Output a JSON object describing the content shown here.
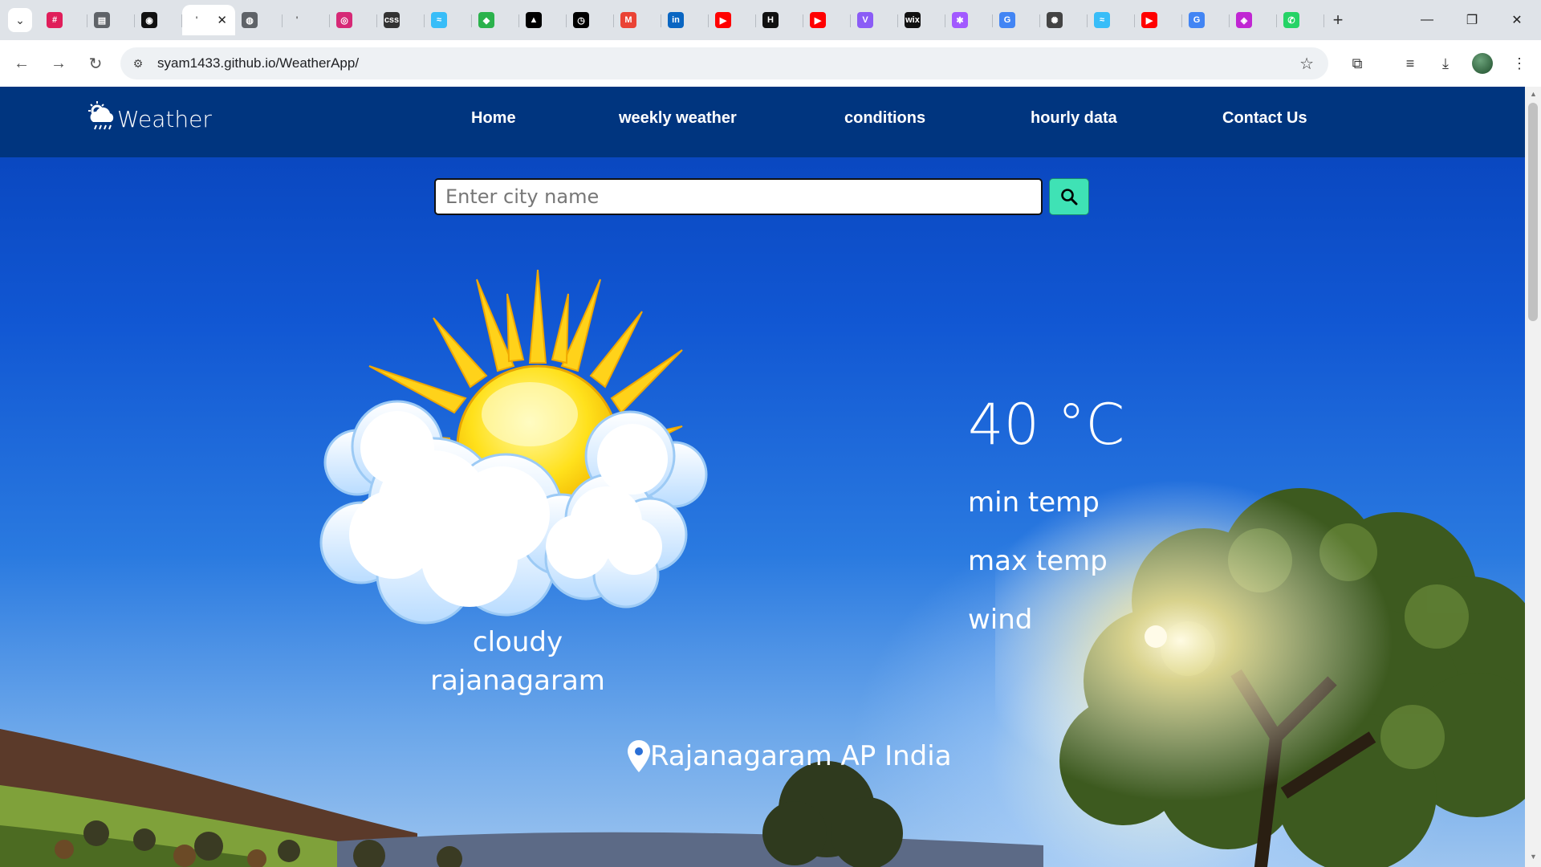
{
  "browser": {
    "tabs": [
      {
        "icon": "slack-icon",
        "color": "#e01e5a",
        "glyph": "#"
      },
      {
        "icon": "doc-icon",
        "color": "#5f6368",
        "glyph": "▤"
      },
      {
        "icon": "github-icon",
        "color": "#111111",
        "glyph": "◉"
      },
      {
        "icon": "active-tab-icon",
        "color": "#ffffff",
        "glyph": "'"
      },
      {
        "icon": "globe-icon",
        "color": "#5f6368",
        "glyph": "◍"
      },
      {
        "icon": "blank-icon",
        "color": "#cccccc",
        "glyph": "'"
      },
      {
        "icon": "instagram-icon",
        "color": "#d62976",
        "glyph": "◎"
      },
      {
        "icon": "css-icon",
        "color": "#333333",
        "glyph": "css"
      },
      {
        "icon": "tailwind-icon",
        "color": "#38bdf8",
        "glyph": "≈"
      },
      {
        "icon": "feedly-icon",
        "color": "#2bb24c",
        "glyph": "◆"
      },
      {
        "icon": "vercel-icon",
        "color": "#000000",
        "glyph": "▲"
      },
      {
        "icon": "alarm-icon",
        "color": "#000000",
        "glyph": "◷"
      },
      {
        "icon": "gmail-icon",
        "color": "#ea4335",
        "glyph": "M"
      },
      {
        "icon": "linkedin-icon",
        "color": "#0a66c2",
        "glyph": "in"
      },
      {
        "icon": "youtube-icon",
        "color": "#ff0000",
        "glyph": "▶"
      },
      {
        "icon": "hackerrank-icon",
        "color": "#111111",
        "glyph": "H"
      },
      {
        "icon": "youtube-icon",
        "color": "#ff0000",
        "glyph": "▶"
      },
      {
        "icon": "vite-icon",
        "color": "#8b5cf6",
        "glyph": "V"
      },
      {
        "icon": "wix-icon",
        "color": "#111111",
        "glyph": "wix"
      },
      {
        "icon": "figma-icon",
        "color": "#a259ff",
        "glyph": "✱"
      },
      {
        "icon": "google-icon",
        "color": "#4285f4",
        "glyph": "G"
      },
      {
        "icon": "openai-icon",
        "color": "#444444",
        "glyph": "✺"
      },
      {
        "icon": "tailwind-icon",
        "color": "#38bdf8",
        "glyph": "≈"
      },
      {
        "icon": "youtube-icon",
        "color": "#ff0000",
        "glyph": "▶"
      },
      {
        "icon": "google-icon",
        "color": "#4285f4",
        "glyph": "G"
      },
      {
        "icon": "app-icon",
        "color": "#c026d3",
        "glyph": "◈"
      },
      {
        "icon": "whatsapp-icon",
        "color": "#25d366",
        "glyph": "✆"
      }
    ],
    "url": "syam1433.github.io/WeatherApp/"
  },
  "app": {
    "brand": "Weather",
    "nav": [
      "Home",
      "weekly weather",
      "conditions",
      "hourly data",
      "Contact Us"
    ],
    "search_placeholder": "Enter city name",
    "condition": "cloudy",
    "city": "rajanagaram",
    "temperature": "40 °C",
    "min_label": "min temp",
    "max_label": "max temp",
    "wind_label": "wind",
    "location": "Rajanagaram AP India"
  }
}
